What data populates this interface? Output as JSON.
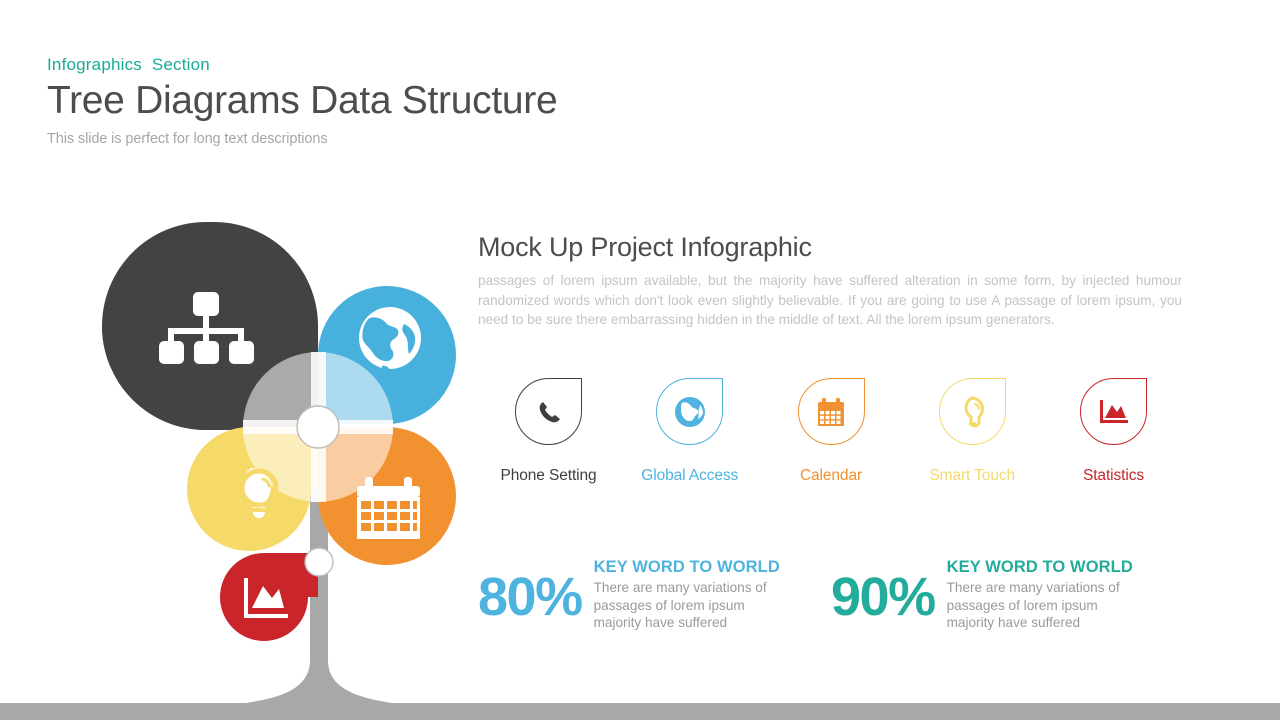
{
  "header": {
    "eyebrow": "Infographics  Section",
    "title": "Tree Diagrams Data Structure",
    "subtitle": "This slide is perfect for long text descriptions",
    "eyebrow_color": "#1aab96",
    "title_color": "#4d4d4d"
  },
  "main": {
    "title": "Mock Up Project Infographic",
    "body": "passages of lorem ipsum available, but the majority have suffered alteration in some form, by injected humour  randomized words which don't look even slightly believable. If you are going to use A passage of lorem ipsum, you need to be sure there embarrassing hidden in the middle of text. All the lorem ipsum generators."
  },
  "features": [
    {
      "label": "Phone Setting",
      "icon": "phone-icon",
      "color": "#3f3f3f"
    },
    {
      "label": "Global Access",
      "icon": "globe-icon",
      "color": "#4fb3e0"
    },
    {
      "label": "Calendar",
      "icon": "calendar-icon",
      "color": "#f2912f"
    },
    {
      "label": "Smart Touch",
      "icon": "lightbulb-icon",
      "color": "#f5d969"
    },
    {
      "label": "Statistics",
      "icon": "area-chart-icon",
      "color": "#c9252b"
    }
  ],
  "stats": [
    {
      "value": "80%",
      "heading": "KEY WORD TO WORLD",
      "body": "There are many variations of\npassages of lorem ipsum\n majority have suffered",
      "color": "#4fb3e0"
    },
    {
      "value": "90%",
      "heading": "KEY WORD TO WORLD",
      "body": "There are many variations of\npassages of lorem ipsum\n majority have suffered",
      "color": "#23ab9b"
    }
  ],
  "diagram": {
    "petals": [
      {
        "name": "hierarchy-petal",
        "icon": "hierarchy-icon",
        "color": "#434343"
      },
      {
        "name": "global-petal",
        "icon": "globe-icon",
        "color": "#48b0dd"
      },
      {
        "name": "calendar-petal",
        "icon": "calendar-icon",
        "color": "#f2912f"
      },
      {
        "name": "idea-petal",
        "icon": "lightbulb-icon",
        "color": "#f5d969"
      },
      {
        "name": "statistics-node",
        "icon": "area-chart-icon",
        "color": "#c9252b"
      }
    ],
    "stem_color": "#a8a8a8",
    "hub_color": "#ffffff"
  }
}
